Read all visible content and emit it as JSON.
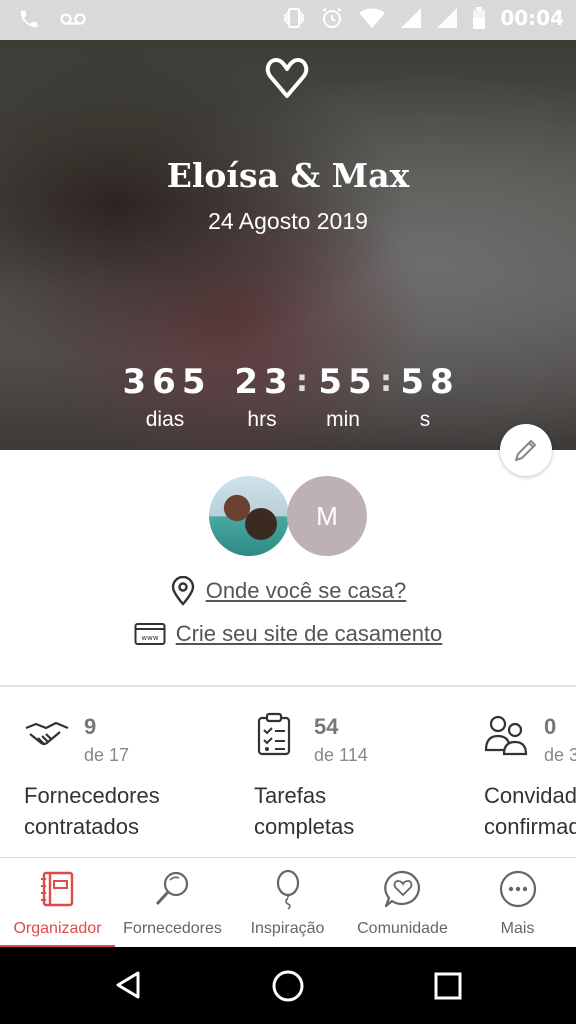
{
  "status_bar": {
    "time": "00:04",
    "icons": [
      "phone-icon",
      "voicemail-icon",
      "vibrate-icon",
      "alarm-icon",
      "wifi-icon",
      "signal-icon",
      "signal-icon",
      "battery-icon"
    ]
  },
  "hero": {
    "couple_name": "Eloísa & Max",
    "wedding_date": "24 Agosto 2019",
    "countdown": {
      "days": "365",
      "days_label": "dias",
      "hours": "23",
      "hours_label": "hrs",
      "minutes": "55",
      "minutes_label": "min",
      "seconds": "58",
      "seconds_label": "s"
    }
  },
  "profile": {
    "partner_initial": "M",
    "location_link": "Onde você se casa?",
    "website_link": "Crie seu site de casamento"
  },
  "stats": [
    {
      "count": "9",
      "total": "de 17",
      "label_line1": "Fornecedores",
      "label_line2": "contratados"
    },
    {
      "count": "54",
      "total": "de 114",
      "label_line1": "Tarefas",
      "label_line2": "completas"
    },
    {
      "count": "0",
      "total": "de 3",
      "label_line1": "Convidados",
      "label_line2": "confirmados"
    }
  ],
  "bottom_nav": [
    {
      "label": "Organizador",
      "icon": "organizer-icon",
      "active": true
    },
    {
      "label": "Fornecedores",
      "icon": "search-icon",
      "active": false
    },
    {
      "label": "Inspiração",
      "icon": "balloon-icon",
      "active": false
    },
    {
      "label": "Comunidade",
      "icon": "chat-heart-icon",
      "active": false
    },
    {
      "label": "Mais",
      "icon": "more-icon",
      "active": false
    }
  ],
  "colors": {
    "accent": "#e04a4a",
    "status_bar": "#d9d9d9"
  }
}
